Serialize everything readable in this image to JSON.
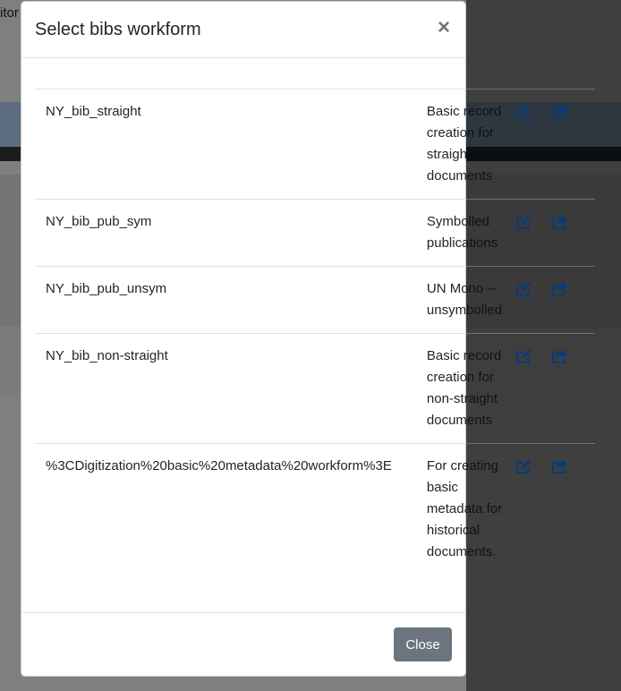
{
  "background": {
    "partial_text": "itor"
  },
  "modal": {
    "title": "Select bibs workform",
    "close_glyph": "×",
    "footer_close_label": "Close",
    "workforms": [
      {
        "name": "NY_bib_straight",
        "description": "Basic record creation for straight documents"
      },
      {
        "name": "NY_bib_pub_sym",
        "description": "Symbolled publications"
      },
      {
        "name": "NY_bib_pub_unsym",
        "description": "UN Mono -- unsymbolled"
      },
      {
        "name": "NY_bib_non-straight",
        "description": "Basic record creation for non-straight documents"
      },
      {
        "name": "%3CDigitization%20basic%20metadata%20workform%3E",
        "description": "For creating basic metadata for historical documents."
      }
    ],
    "row_actions": [
      {
        "icon": "edit-icon"
      },
      {
        "icon": "share-icon"
      }
    ]
  },
  "colors": {
    "link": "#007bff",
    "secondary": "#6c757d",
    "border": "#dee2e6"
  }
}
